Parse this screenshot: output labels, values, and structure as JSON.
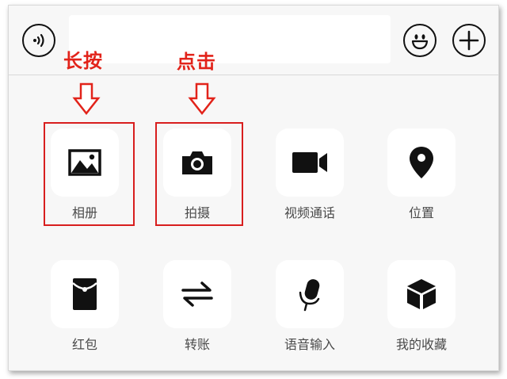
{
  "annotations": {
    "long_press": "长按",
    "click": "点击"
  },
  "input": {
    "value": "",
    "placeholder": ""
  },
  "actions": [
    {
      "label": "相册",
      "icon": "photo-album-icon"
    },
    {
      "label": "拍摄",
      "icon": "camera-icon"
    },
    {
      "label": "视频通话",
      "icon": "video-call-icon"
    },
    {
      "label": "位置",
      "icon": "location-pin-icon"
    },
    {
      "label": "红包",
      "icon": "red-envelope-icon"
    },
    {
      "label": "转账",
      "icon": "transfer-arrows-icon"
    },
    {
      "label": "语音输入",
      "icon": "microphone-icon"
    },
    {
      "label": "我的收藏",
      "icon": "favorites-cube-icon"
    }
  ],
  "colors": {
    "annotation": "#e2231a",
    "highlight_border": "#d81e1e",
    "panel_background": "#f7f7f7",
    "tile_background": "#ffffff",
    "icon": "#111111",
    "label_text": "#4a4a4a"
  }
}
